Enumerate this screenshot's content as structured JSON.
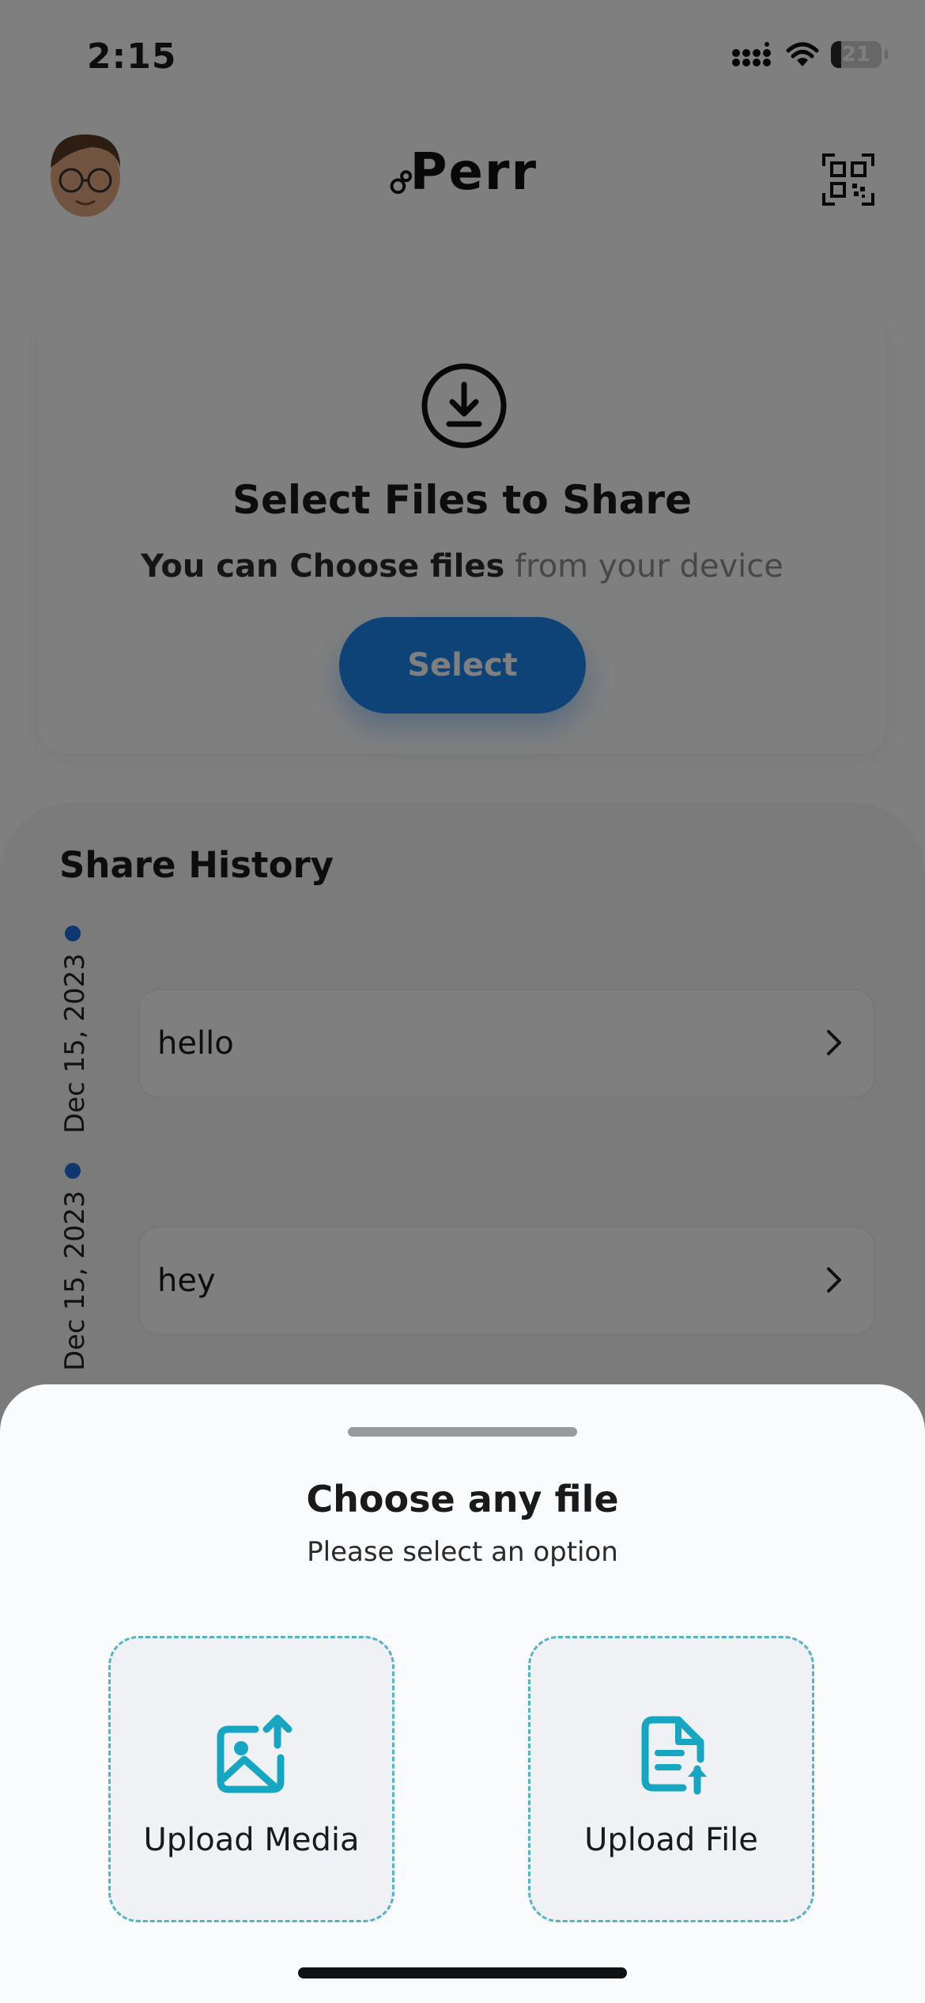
{
  "status_bar": {
    "time": "2:15",
    "battery_level": "21",
    "battery_fraction": 0.21,
    "icons": [
      "cellular-signal-icon",
      "wifi-icon",
      "battery-icon"
    ]
  },
  "header": {
    "logo_text": "Perr",
    "icons": [
      "avatar",
      "qr-code-icon"
    ]
  },
  "select_card": {
    "icon": "download-icon",
    "title": "Select Files to Share",
    "subtitle_strong": "You can Choose files",
    "subtitle_light": " from your device",
    "button_label": "Select"
  },
  "history": {
    "title": "Share History",
    "items": [
      {
        "date": "Dec 15, 2023",
        "label": "hello"
      },
      {
        "date": "Dec 15, 2023",
        "label": "hey"
      }
    ]
  },
  "sheet": {
    "title": "Choose any file",
    "subtitle": "Please select an option",
    "options": [
      {
        "label": "Upload Media",
        "icon": "upload-media-icon"
      },
      {
        "label": "Upload File",
        "icon": "upload-file-icon"
      }
    ]
  },
  "colors": {
    "accent_blue": "#1d86f0",
    "timeline_dot": "#1d6fe0",
    "option_teal": "#17a6c2",
    "option_border": "#55b3c6"
  }
}
